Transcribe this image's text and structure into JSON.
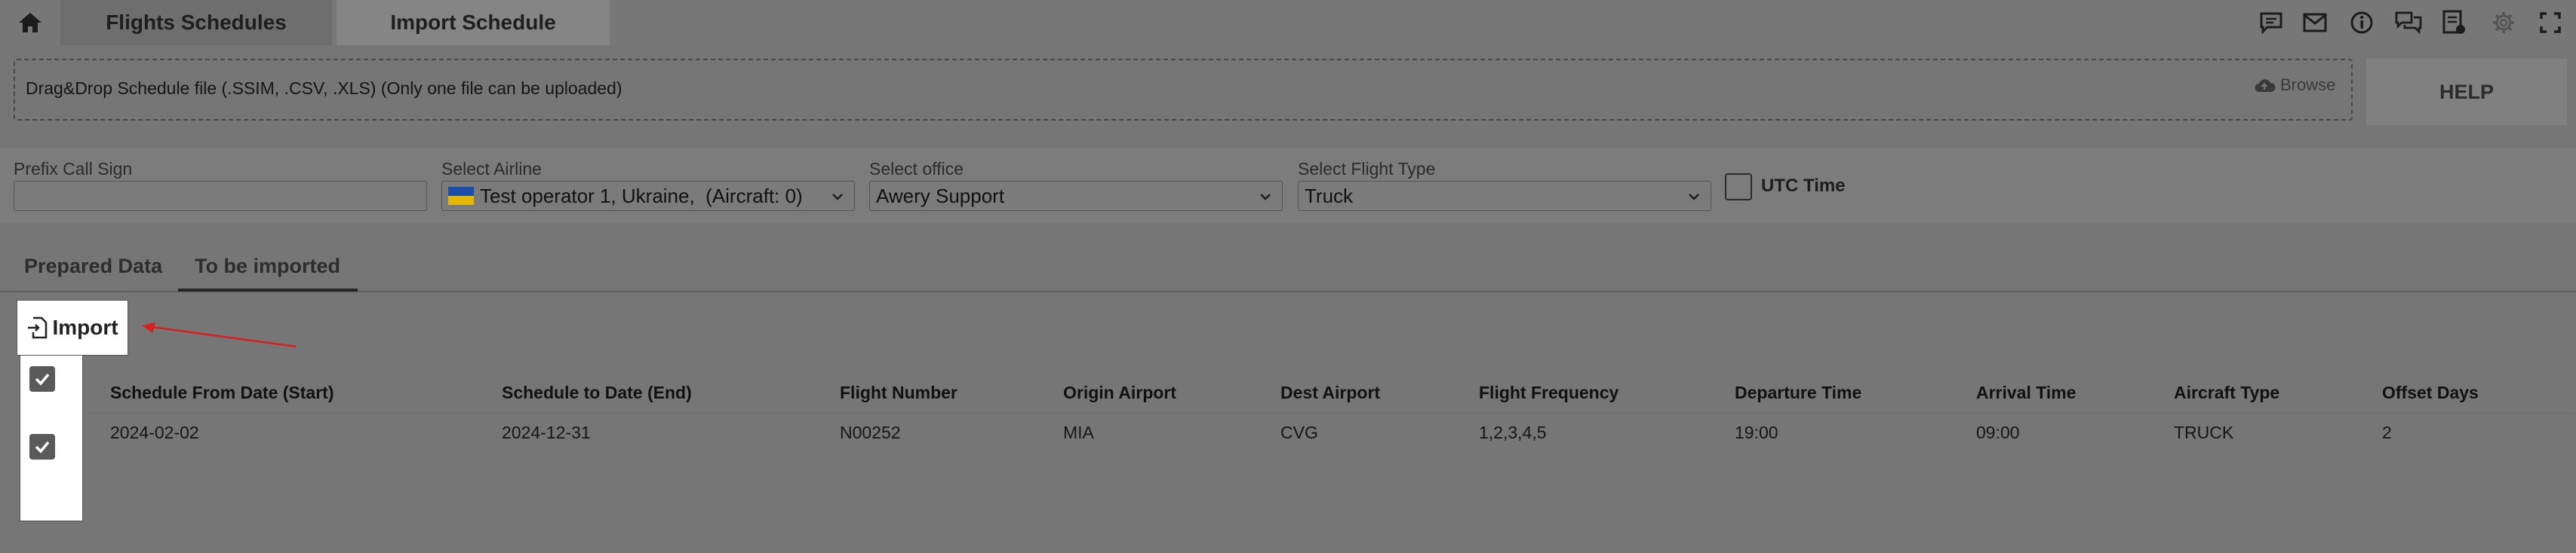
{
  "topbar": {
    "home_icon": "home-icon",
    "tabs": [
      {
        "label": "Flights Schedules"
      },
      {
        "label": "Import Schedule"
      }
    ],
    "icons": [
      "chat-icon",
      "mail-icon",
      "info-icon",
      "conversations-icon",
      "report-icon",
      "gear-icon",
      "fullscreen-icon"
    ]
  },
  "upload": {
    "dropzone_text": "Drag&Drop Schedule file (.SSIM, .CSV, .XLS) (Only one file can be uploaded)",
    "browse_label": "Browse",
    "help_label": "HELP"
  },
  "filters": {
    "prefix_call_sign": {
      "label": "Prefix Call Sign",
      "value": ""
    },
    "airline": {
      "label": "Select Airline",
      "value": "Test operator 1, Ukraine,  (Aircraft: 0)"
    },
    "office": {
      "label": "Select office",
      "value": "Awery Support"
    },
    "flight_type": {
      "label": "Select Flight Type",
      "value": "Truck"
    },
    "utc_time": {
      "label": "UTC Time",
      "checked": false
    }
  },
  "tabs": [
    {
      "label": "Prepared Data",
      "active": false
    },
    {
      "label": "To be imported",
      "active": true
    }
  ],
  "import_button": {
    "label": "Import"
  },
  "table": {
    "columns": [
      "Schedule From Date (Start)",
      "Schedule to Date (End)",
      "Flight Number",
      "Origin Airport",
      "Dest Airport",
      "Flight Frequency",
      "Departure Time",
      "Arrival Time",
      "Aircraft Type",
      "Offset Days"
    ],
    "header_checked": true,
    "rows": [
      {
        "checked": true,
        "cells": [
          "2024-02-02",
          "2024-12-31",
          "N00252",
          "MIA",
          "CVG",
          "1,2,3,4,5",
          "19:00",
          "09:00",
          "TRUCK",
          "2"
        ]
      }
    ]
  },
  "colors": {
    "overlay": "#767676",
    "annotation_arrow": "#d81f1f",
    "flag_blue": "#1c4ea8",
    "flag_yellow": "#e2b800"
  }
}
